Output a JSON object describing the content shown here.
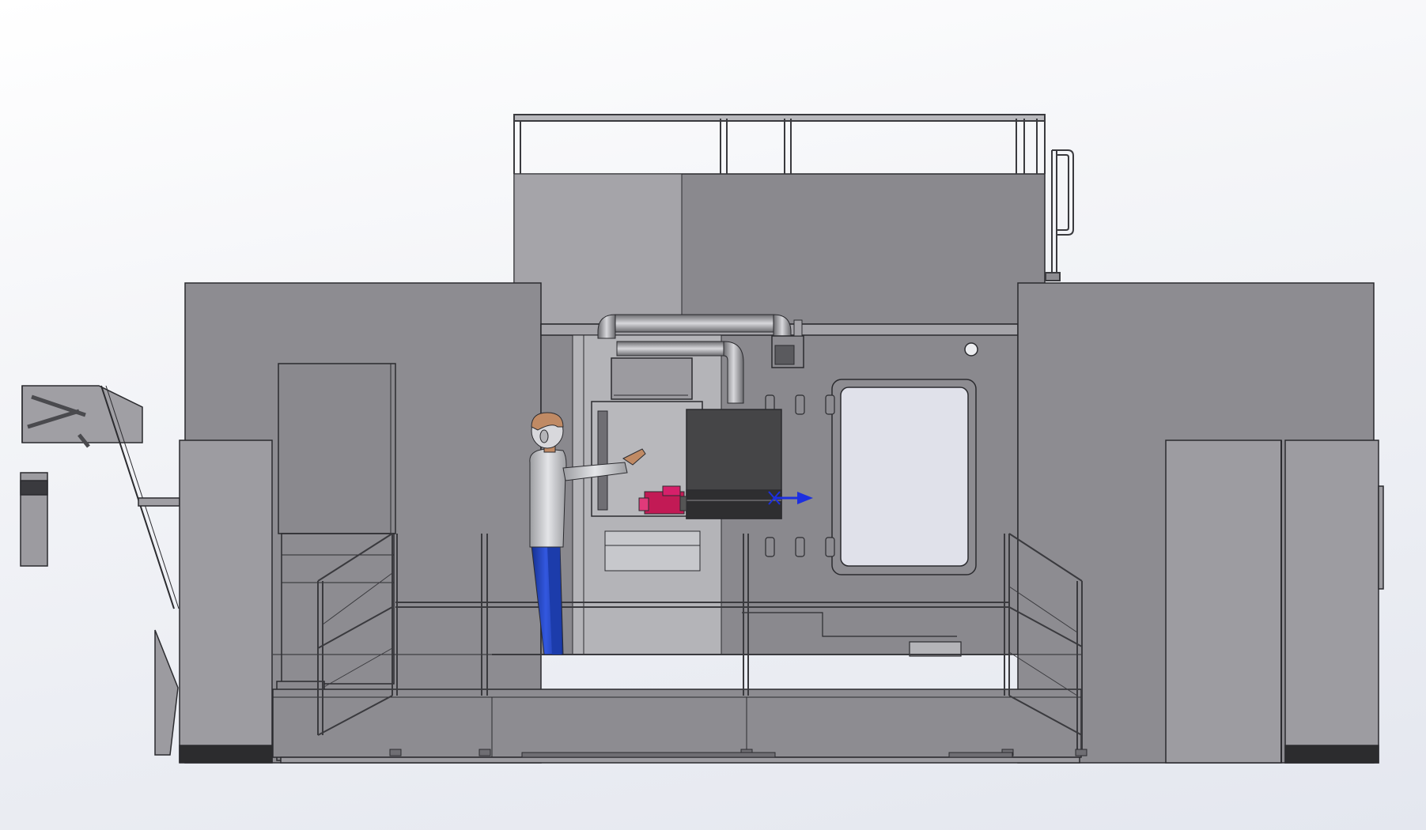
{
  "viewport": {
    "background_top": "#ffffff",
    "background_bottom": "#e4e7ef"
  },
  "model": {
    "body_color": "#8d8c91",
    "body_light": "#a7a6ab",
    "body_dark": "#6f6e73",
    "line_color": "#2b2b2f",
    "window_color": "#e0e1ea",
    "head_cover_color": "#454547",
    "worker_shirt_color": "#c9cacd",
    "worker_pants_color": "#1f3fb5",
    "worker_skin_color": "#c08a64",
    "part_highlight_color": "#c21a55",
    "triad_color": "#1c2fe0",
    "base_stripe_color": "#2c2c2e"
  }
}
